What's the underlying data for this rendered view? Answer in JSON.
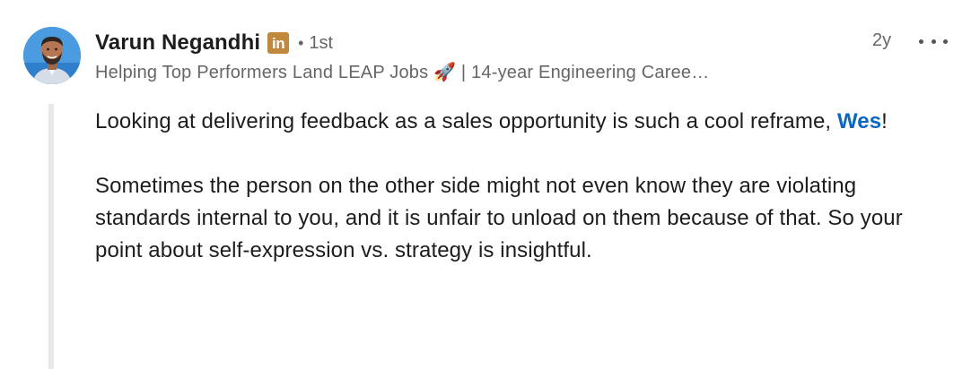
{
  "author": {
    "name": "Varun Negandhi",
    "badge": "in",
    "degree_separator": "•",
    "degree": "1st",
    "headline": "Helping Top Performers Land LEAP Jobs 🚀 | 14-year Engineering Caree…"
  },
  "timestamp": "2y",
  "more_icon": "ellipsis-icon",
  "colors": {
    "mention": "#0a66c2",
    "badge": "#c0883a",
    "secondary_text": "#666666",
    "thread_line": "#e8e8e6"
  },
  "comment": {
    "p1_before": "Looking at delivering feedback as a sales opportunity is such a cool reframe, ",
    "mention": "Wes",
    "p1_after": "!",
    "p2": "Sometimes the person on the other side might not even know they are violating standards internal to you, and it is unfair to unload on them because of that. So your point about self-expression vs. strategy is insightful."
  }
}
